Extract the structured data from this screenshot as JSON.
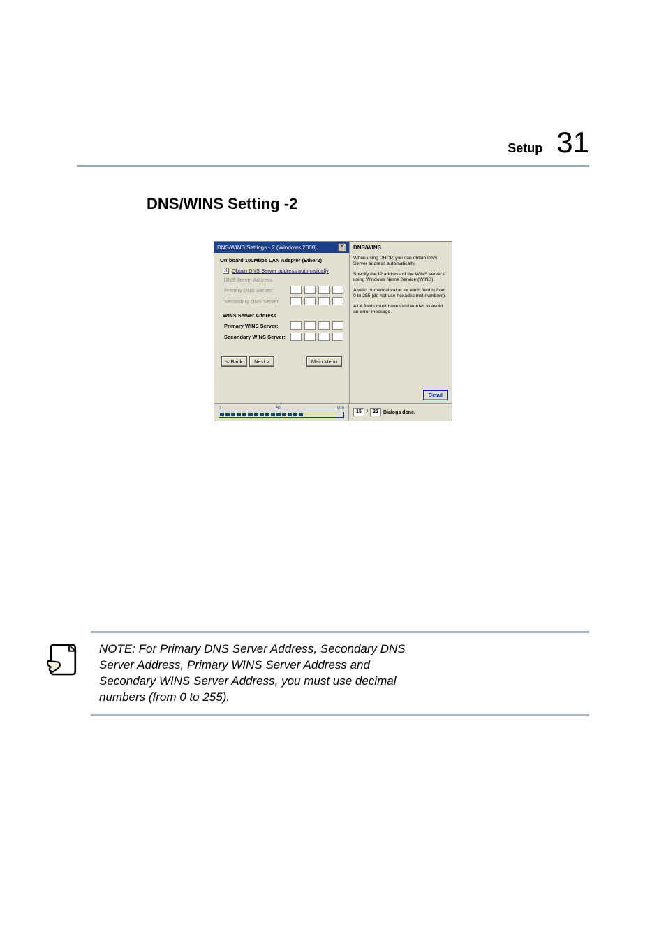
{
  "header": {
    "label": "Setup",
    "page_number": "31"
  },
  "section_title": "DNS/WINS Setting -2",
  "dialog": {
    "title": "DNS/WINS Settings - 2 (Windows 2000)",
    "close_glyph": "X",
    "subtitle": "On-board 100Mbps LAN Adapter (Ether2)",
    "checkbox": {
      "checked_glyph": "X",
      "label": "Obtain DNS Server address automatically"
    },
    "dns_group_label": "DNS Server Address",
    "primary_dns_label": "Primary DNS Server:",
    "secondary_dns_label": "Secondary DNS Server:",
    "wins_group_label": "WINS Server Address",
    "primary_wins_label": "Primary WINS Server:",
    "secondary_wins_label": "Secondary WINS Server:",
    "buttons": {
      "back": "< Back",
      "next": "Next >",
      "main": "Main Menu"
    }
  },
  "help": {
    "title": "DNS/WINS",
    "p1": "When using DHCP, you can obtain DNS Server address automatically.",
    "p2": "Specify the IP address of the WINS server if using Windows Name Service (WINS).",
    "p3": "A valid numerical value for each field is from 0 to 255 (do not use hexadecimal numbers).",
    "p4": "All 4 fields must have valid entries to avoid an error message.",
    "detail_button": "Detail"
  },
  "footer": {
    "scale": {
      "min": "0",
      "mid": "50",
      "max": "100"
    },
    "dialogs_done": {
      "current": "15",
      "sep": "/",
      "total": "22",
      "label": "Dialogs done."
    }
  },
  "note": "NOTE: For Primary DNS Server Address, Secondary DNS Server Address, Primary WINS Server Address and Secondary WINS Server Address, you must use decimal numbers (from 0 to 255)."
}
